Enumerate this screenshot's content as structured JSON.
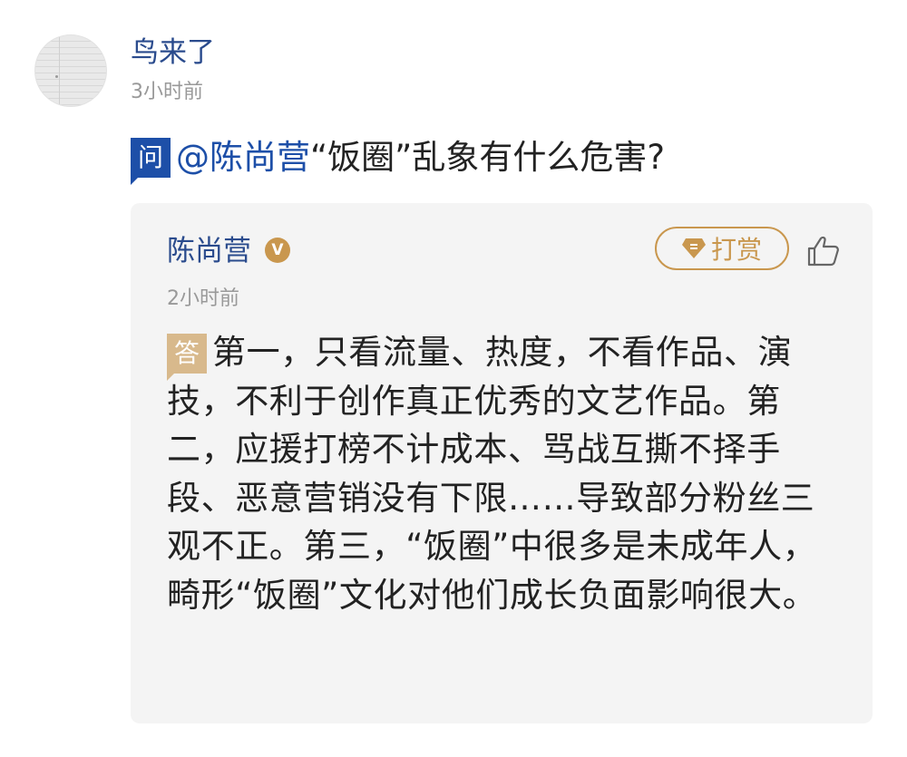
{
  "post": {
    "author": {
      "name": "鸟来了",
      "time": "3小时前",
      "avatar": "avatar-image"
    },
    "question": {
      "badge": "问",
      "mention": "@陈尚营",
      "text": "“饭圈”乱象有什么危害?"
    },
    "answer": {
      "author": "陈尚营",
      "verified_badge": "V",
      "tip_label": "打赏",
      "tip_icon": "gem-icon",
      "like_icon": "thumbs-up-icon",
      "time": "2小时前",
      "badge": "答",
      "text": "第一，只看流量、热度，不看作品、演技，不利于创作真正优秀的文艺作品。第二，应援打榜不计成本、骂战互撕不择手段、恶意营销没有下限……导致部分粉丝三观不正。第三，“饭圈”中很多是未成年人，畸形“饭圈”文化对他们成长负面影响很大。"
    }
  },
  "colors": {
    "link_blue": "#2a4b8d",
    "question_badge": "#1d4fa8",
    "answer_badge": "#d8b98c",
    "tip_gold": "#c9974e",
    "card_background": "#f4f4f4"
  }
}
